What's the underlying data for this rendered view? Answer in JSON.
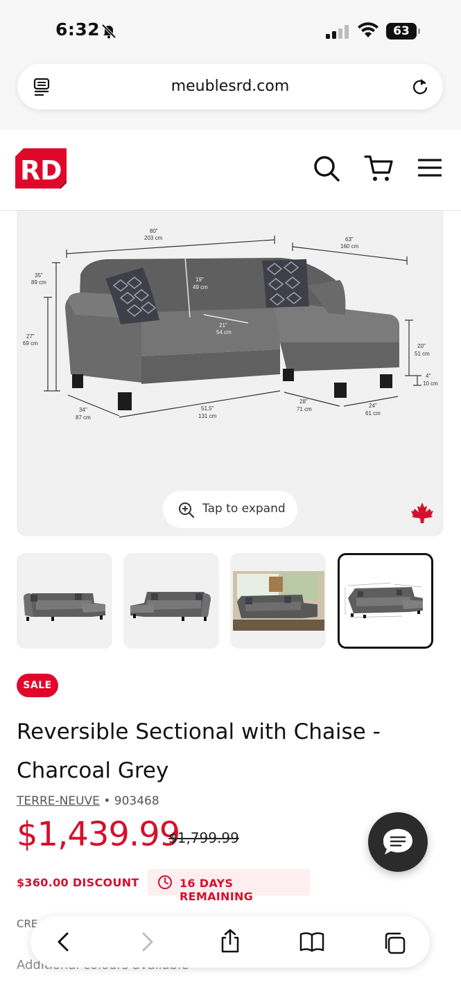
{
  "status_bar": {
    "time": "6:32",
    "battery": "63"
  },
  "browser": {
    "url": "meublesrd.com"
  },
  "site": {
    "logo_text": "RD",
    "brand_color": "#e0082a"
  },
  "gallery": {
    "dimensions": {
      "overall_width": "80\"",
      "overall_width_cm": "203 cm",
      "chaise_length": "63\"",
      "chaise_length_cm": "160 cm",
      "height": "35\"",
      "height_cm": "89 cm",
      "arm_height": "27\"",
      "arm_height_cm": "69 cm",
      "back_depth": "19\"",
      "back_depth_cm": "49 cm",
      "seat_depth": "21\"",
      "seat_depth_cm": "54 cm",
      "seat_height": "20\"",
      "seat_height_cm": "51 cm",
      "leg_height": "4\"",
      "leg_height_cm": "10 cm",
      "depth": "34\"",
      "depth_cm": "87 cm",
      "seat_width": "51,5\"",
      "seat_width_cm": "131 cm",
      "chaise_width": "28\"",
      "chaise_width_cm": "71 cm",
      "chaise_depth": "24\"",
      "chaise_depth_cm": "61 cm"
    },
    "expand_label": "Tap to expand",
    "thumbnail_count": 4,
    "selected_thumbnail": 4
  },
  "product": {
    "badge": "SALE",
    "title": "Reversible Sectional with Chaise - Charcoal Grey",
    "collection": "TERRE-NEUVE",
    "separator": "•",
    "sku": "903468",
    "price": "$1,439.99",
    "old_price": "$1,799.99",
    "discount": "$360.00 DISCOUNT",
    "days_remaining": "16 DAYS REMAINING",
    "credit_text": "CRE",
    "colors_text": "Additional colours available"
  },
  "colors": {
    "accent": "#d5102c",
    "pill_bg": "#fdeef0",
    "sofa": "#6e6e6e"
  }
}
